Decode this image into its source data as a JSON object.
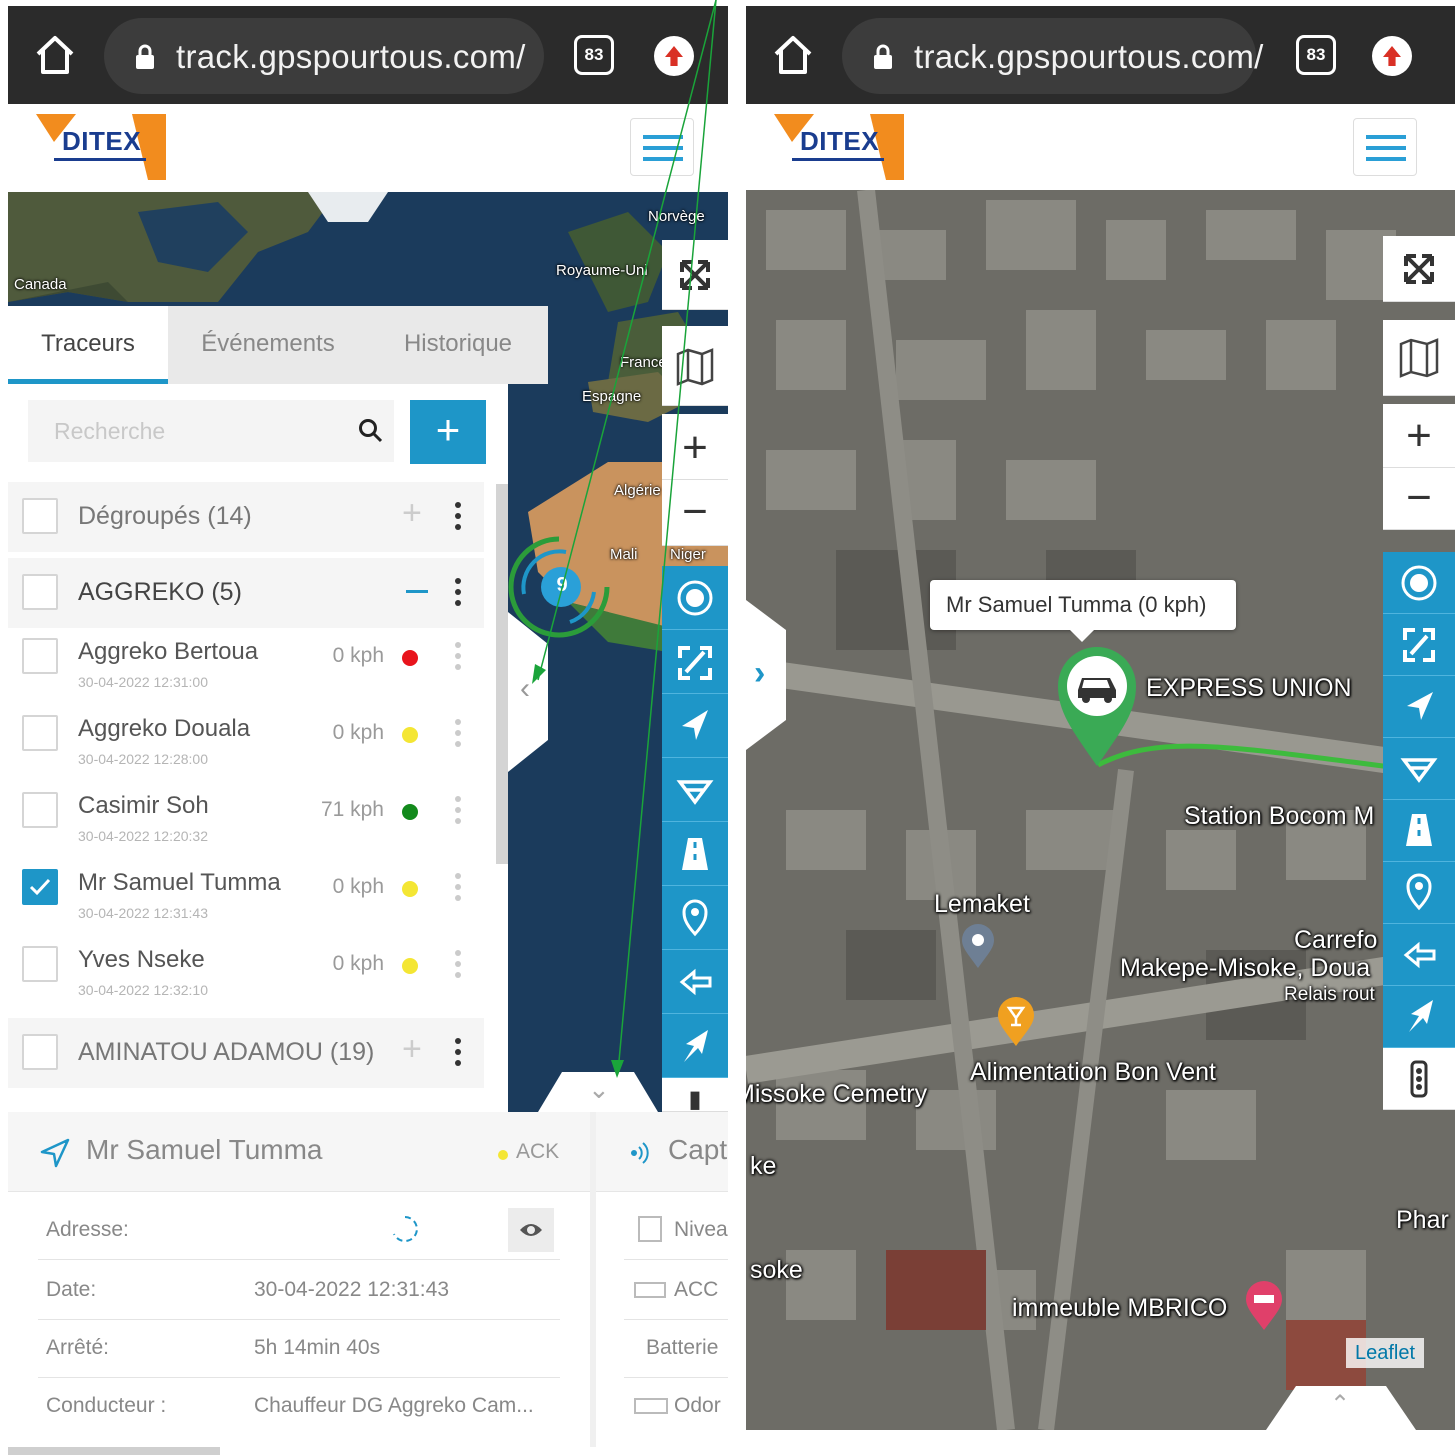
{
  "browser": {
    "url": "track.gpspourtous.com/",
    "tab_count": "83"
  },
  "app": {
    "logo_text": "DITEX"
  },
  "left_map": {
    "labels": [
      "Canada",
      "Norvège",
      "Royaume-Uni",
      "France",
      "Espagne",
      "Algérie",
      "Mali",
      "Niger"
    ],
    "cluster_count": "9"
  },
  "tabs": {
    "trackers": "Traceurs",
    "events": "Événements",
    "history": "Historique"
  },
  "search": {
    "placeholder": "Recherche"
  },
  "groups": [
    {
      "name": "Dégroupés (14)",
      "expanded": false
    },
    {
      "name": "AGGREKO (5)",
      "expanded": true
    },
    {
      "name": "AMINATOU ADAMOU (19)",
      "expanded": false
    }
  ],
  "trackers": [
    {
      "name": "Aggreko Bertoua",
      "date": "30-04-2022 12:31:00",
      "speed": "0 kph",
      "status_color": "#e8141c",
      "checked": false
    },
    {
      "name": "Aggreko Douala",
      "date": "30-04-2022 12:28:00",
      "speed": "0 kph",
      "status_color": "#f4e634",
      "checked": false
    },
    {
      "name": "Casimir Soh",
      "date": "30-04-2022 12:20:32",
      "speed": "71 kph",
      "status_color": "#138a1c",
      "checked": false
    },
    {
      "name": "Mr Samuel Tumma",
      "date": "30-04-2022 12:31:43",
      "speed": "0 kph",
      "status_color": "#f4e634",
      "checked": true
    },
    {
      "name": "Yves Nseke",
      "date": "30-04-2022 12:32:10",
      "speed": "0 kph",
      "status_color": "#f4e634",
      "checked": false
    }
  ],
  "info_panel": {
    "title": "Mr Samuel Tumma",
    "ack": "ACK",
    "rows": [
      {
        "label": "Adresse:",
        "value": ""
      },
      {
        "label": "Date:",
        "value": "30-04-2022 12:31:43"
      },
      {
        "label": "Arrêté:",
        "value": "5h 14min 40s"
      },
      {
        "label": "Conducteur :",
        "value": "Chauffeur DG Aggreko Cam..."
      }
    ]
  },
  "sensors_panel": {
    "title": "Capte",
    "rows": [
      "Nivea",
      "ACC",
      "Batterie",
      "Odor"
    ]
  },
  "right_map": {
    "popup": "Mr Samuel Tumma (0 kph)",
    "labels": {
      "express_union": "EXPRESS UNION",
      "station_bocom": "Station Bocom M",
      "lemaket": "Lemaket",
      "carrefour": "Carrefo",
      "makepe": "Makepe-Misoke, Doua",
      "relais": "Relais rout",
      "alimentation": "Alimentation Bon Vent",
      "cemetry": "Missoke Cemetry",
      "ke": "ke",
      "soke": "soke",
      "pha": "Phar",
      "immeuble": "immeuble MBRICO"
    },
    "attribution": "Leaflet"
  },
  "colors": {
    "accent": "#1e96c8",
    "browser_bar": "#2b2b2b",
    "route": "#3dbb3d",
    "marker": "#3aaa55"
  }
}
